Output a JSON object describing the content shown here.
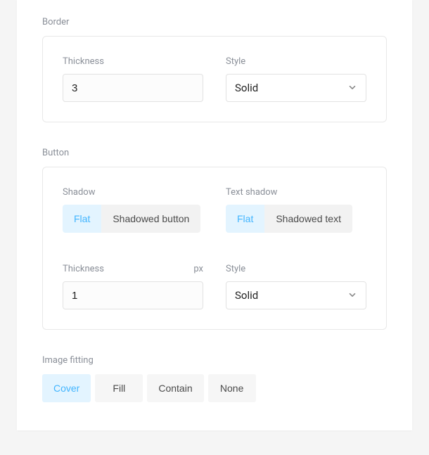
{
  "border": {
    "title": "Border",
    "thickness_label": "Thickness",
    "thickness_value": "3",
    "style_label": "Style",
    "style_value": "Solid"
  },
  "button": {
    "title": "Button",
    "shadow_label": "Shadow",
    "shadow_options": {
      "flat": "Flat",
      "shadowed": "Shadowed button"
    },
    "text_shadow_label": "Text shadow",
    "text_shadow_options": {
      "flat": "Flat",
      "shadowed": "Shadowed text"
    },
    "thickness_label": "Thickness",
    "thickness_suffix": "px",
    "thickness_value": "1",
    "style_label": "Style",
    "style_value": "Solid"
  },
  "image_fitting": {
    "title": "Image fitting",
    "options": {
      "cover": "Cover",
      "fill": "Fill",
      "contain": "Contain",
      "none": "None"
    }
  }
}
